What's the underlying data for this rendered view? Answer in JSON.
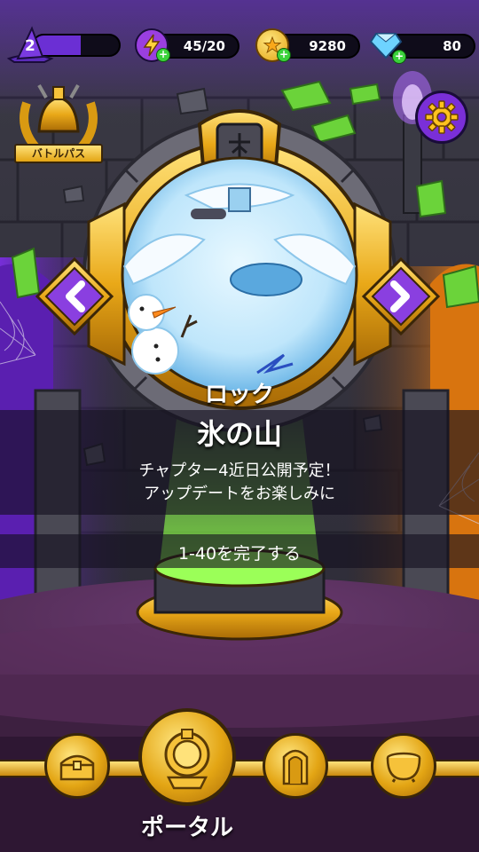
{
  "hud": {
    "level": "2",
    "level_progress": 0.55,
    "energy": "45/20",
    "coins": "9280",
    "gems": "80"
  },
  "battle_pass": {
    "label": "バトルパス"
  },
  "stage": {
    "status": "ロック",
    "name": "氷の山",
    "message_line1": "チャプター4近日公開予定！",
    "message_line2": "アップデートをお楽しみに",
    "requirement": "1-40を完了する"
  },
  "bottom_nav": {
    "items": [
      {
        "icon": "treasure-chest-icon"
      },
      {
        "icon": "portal-icon",
        "selected": true
      },
      {
        "icon": "door-icon"
      },
      {
        "icon": "cauldron-icon"
      }
    ],
    "selected_label": "ポータル"
  },
  "colors": {
    "purple": "#6b2fd4",
    "gold": "#f2b81f",
    "green_glow": "#7dff3a",
    "orange_glow": "#ff8a1c"
  }
}
